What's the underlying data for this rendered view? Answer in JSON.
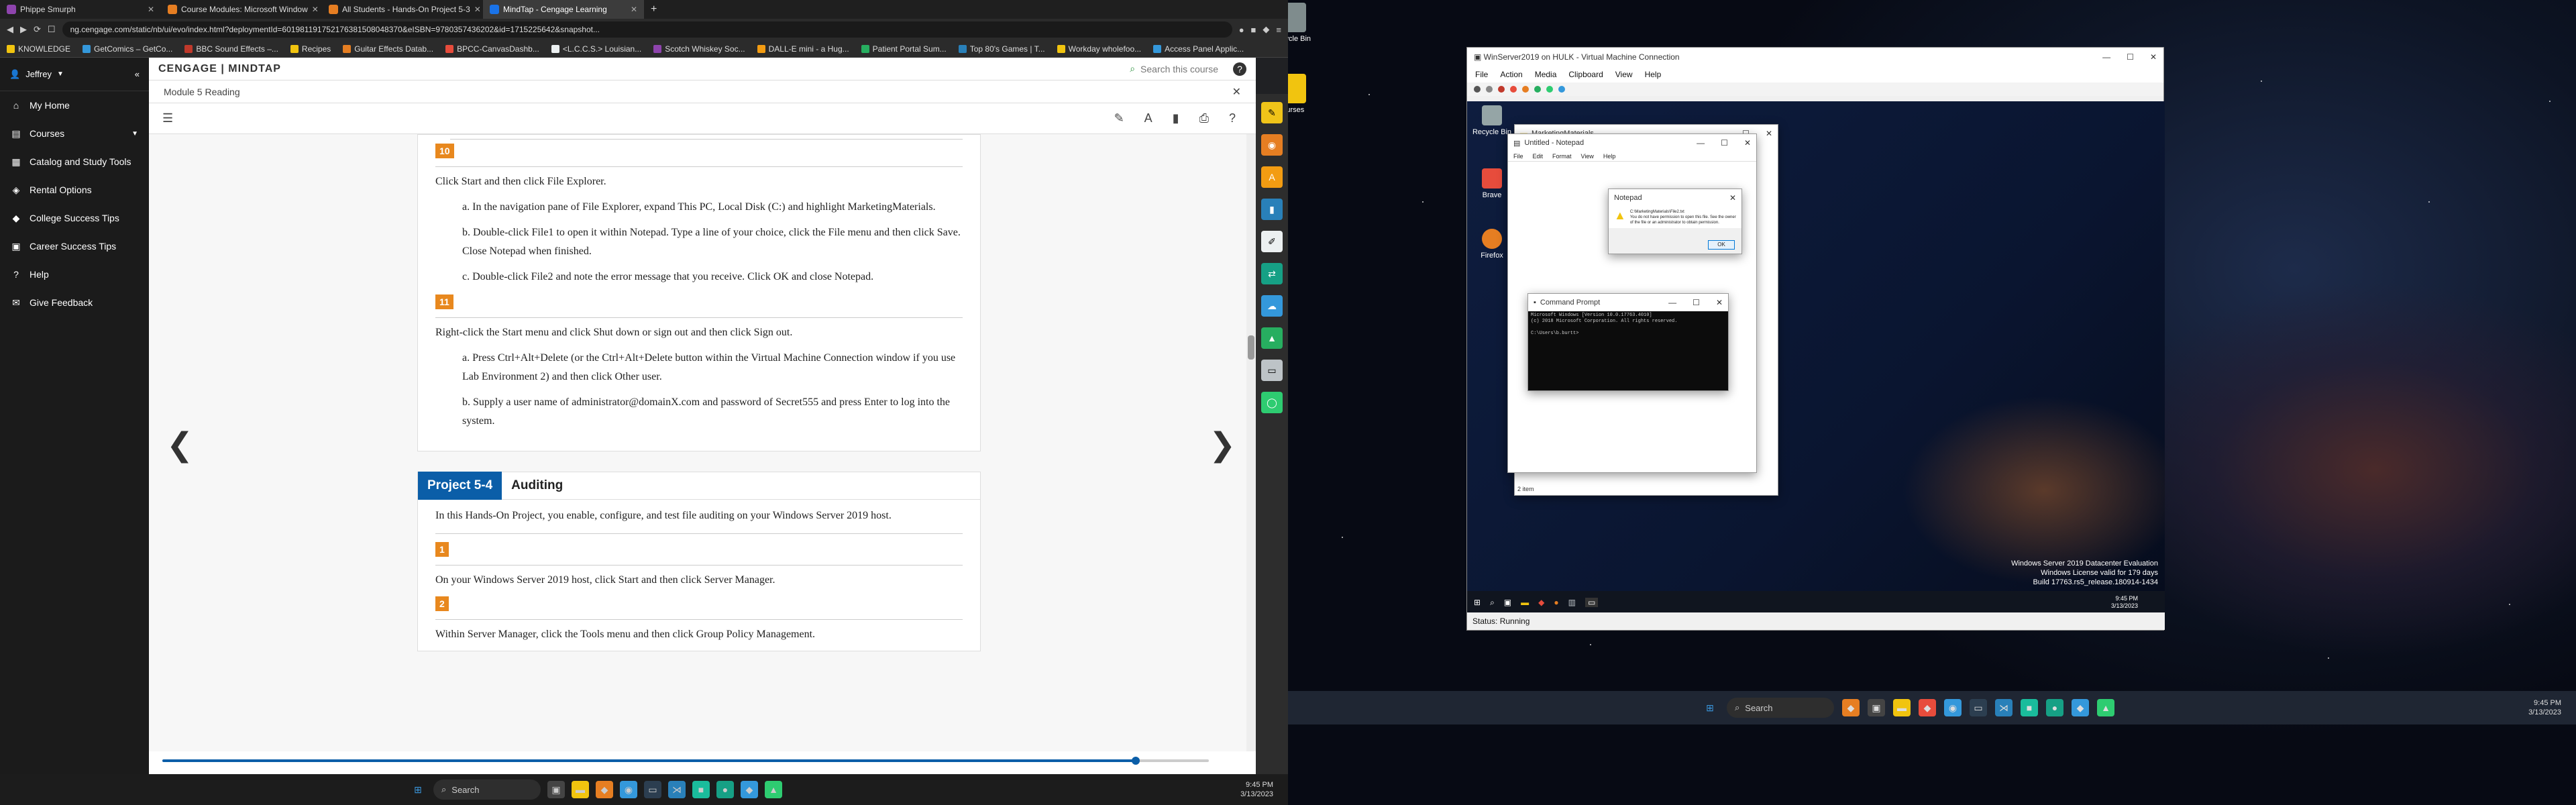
{
  "browser": {
    "tabs": [
      {
        "label": "Phippe Smurph",
        "color": "#8e44ad"
      },
      {
        "label": "Course Modules: Microsoft Window",
        "color": "#e67e22"
      },
      {
        "label": "All Students - Hands-On Project 5-3",
        "color": "#e67e22"
      },
      {
        "label": "MindTap - Cengage Learning",
        "color": "#1a73e8"
      }
    ],
    "url": "ng.cengage.com/static/nb/ui/evo/index.html?deploymentId=601981191752176381508048370&eISBN=9780357436202&id=1715225642&snapshot...",
    "bookmarks": [
      "KNOWLEDGE",
      "GetComics – GetCo...",
      "BBC Sound Effects –...",
      "Recipes",
      "Guitar Effects Datab...",
      "BPCC-CanvasDashb...",
      "<L.C.C.S.> Louisian...",
      "Scotch Whiskey Soc...",
      "DALL-E mini - a Hug...",
      "Patient Portal Sum...",
      "Top 80's Games | T...",
      "Workday wholefoo...",
      "Access Panel Applic..."
    ]
  },
  "sidebar": {
    "user": "Jeffrey",
    "items": [
      "My Home",
      "Courses",
      "Catalog and Study Tools",
      "Rental Options",
      "College Success Tips",
      "Career Success Tips",
      "Help",
      "Give Feedback"
    ]
  },
  "mindtap": {
    "brand": "CENGAGE | MINDTAP",
    "search": "Search this course",
    "module": "Module 5 Reading"
  },
  "reading": {
    "step10_num": "10",
    "step10": "Click Start and then click File Explorer.",
    "step10a": "In the navigation pane of File Explorer, expand This PC, Local Disk (C:) and highlight MarketingMaterials.",
    "step10b": "Double-click File1 to open it within Notepad. Type a line of your choice, click the File menu and then click Save. Close Notepad when finished.",
    "step10c": "Double-click File2 and note the error message that you receive. Click OK and close Notepad.",
    "step11_num": "11",
    "step11": "Right-click the Start menu and click Shut down or sign out and then click Sign out.",
    "step11a": "Press Ctrl+Alt+Delete (or the Ctrl+Alt+Delete button within the Virtual Machine Connection window if you use Lab Environment 2) and then click Other user.",
    "step11b": "Supply a user name of administrator@domainX.com and password of Secret555 and press Enter to log into the system.",
    "project_tag": "Project 5-4",
    "project_title": "Auditing",
    "project_intro": "In this Hands-On Project, you enable, configure, and test file auditing on your Windows Server 2019 host.",
    "p1_num": "1",
    "p1": "On your Windows Server 2019 host, click Start and then click Server Manager.",
    "p2_num": "2",
    "p2": "Within Server Manager, click the Tools menu and then click Group Policy Management."
  },
  "progress": {
    "value": 0.93
  },
  "taskbar1": {
    "search": "Search",
    "time": "9:45 PM",
    "date": "3/13/2023"
  },
  "desktop": {
    "recycle": "Recycle Bin",
    "courses": "courses"
  },
  "vm": {
    "title": "WinServer2019 on HULK - Virtual Machine Connection",
    "menu": [
      "File",
      "Action",
      "Media",
      "Clipboard",
      "View",
      "Help"
    ],
    "status": "Status: Running",
    "desk_icons": [
      "Recycle Bin",
      "Brave",
      "Firefox"
    ],
    "explorer_title": "MarketingMaterials",
    "notepad_title": "Untitled - Notepad",
    "notepad_menu": [
      "File",
      "Edit",
      "Format",
      "View",
      "Help"
    ],
    "dialog_title": "Notepad",
    "dialog_path": "C:\\MarketingMaterials\\File2.txt",
    "dialog_msg1": "You do not have permission to open this file.  See the owner",
    "dialog_msg2": "of the file or an administrator to obtain permission.",
    "dialog_ok": "OK",
    "cmd_title": "Command Prompt",
    "cmd_l1": "Microsoft Windows [Version 10.0.17763.4010]",
    "cmd_l2": "(c) 2018 Microsoft Corporation. All rights reserved.",
    "cmd_l3": "C:\\Users\\b.burtt>",
    "items_label": "2 item",
    "wm1": "Windows Server 2019 Datacenter Evaluation",
    "wm2": "Windows License valid for 179 days",
    "wm3": "Build 17763.rs5_release.180914-1434",
    "vtime": "9:45 PM",
    "vdate": "3/13/2023"
  },
  "taskbar2": {
    "search": "Search",
    "time": "9:45 PM",
    "date": "3/13/2023"
  }
}
